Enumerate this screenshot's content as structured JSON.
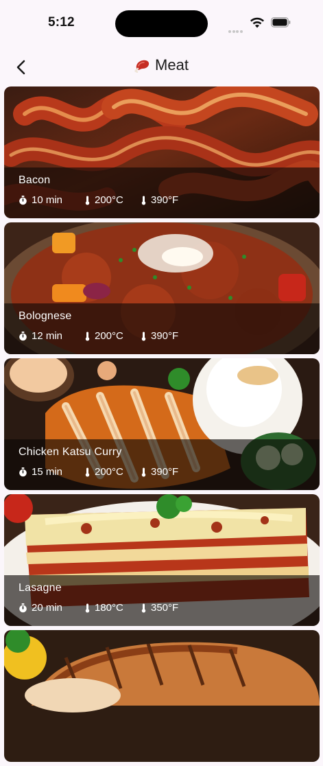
{
  "status_bar": {
    "time": "5:12",
    "icons": [
      "cellular-signal-icon",
      "wifi-icon",
      "battery-icon"
    ]
  },
  "header": {
    "back_icon": "chevron-left-icon",
    "category_icon": "meat-icon",
    "title": "Meat"
  },
  "recipes": [
    {
      "name": "Bacon",
      "time": "10 min",
      "temp_c": "200°C",
      "temp_f": "390°F"
    },
    {
      "name": "Bolognese",
      "time": "12 min",
      "temp_c": "200°C",
      "temp_f": "390°F"
    },
    {
      "name": "Chicken Katsu Curry",
      "time": "15 min",
      "temp_c": "200°C",
      "temp_f": "390°F"
    },
    {
      "name": "Lasagne",
      "time": "20 min",
      "temp_c": "180°C",
      "temp_f": "350°F"
    }
  ],
  "meta_icons": {
    "time": "stopwatch-icon",
    "temperature": "thermometer-icon"
  },
  "colors": {
    "background": "#fbf6fb",
    "overlay": "rgba(12,8,6,0.62)",
    "text_on_image": "#ffffff",
    "meat_icon": "#c62d24"
  }
}
